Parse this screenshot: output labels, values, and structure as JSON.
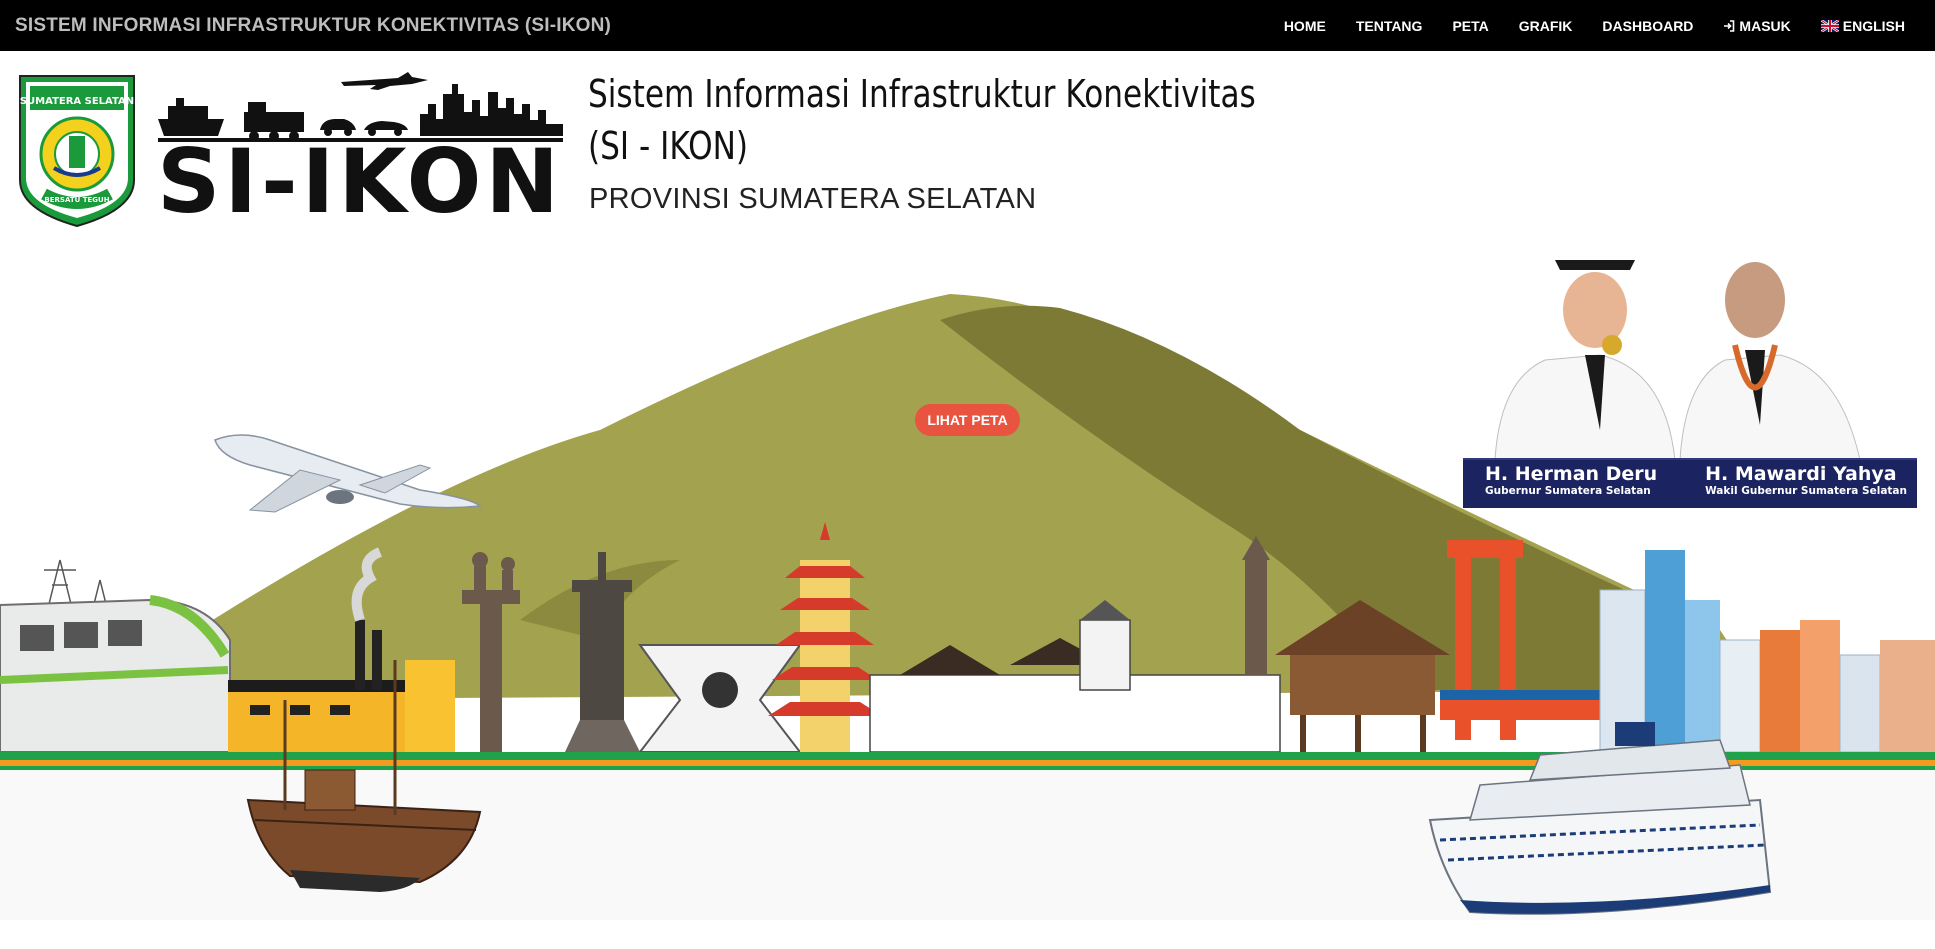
{
  "navbar": {
    "brand": "SISTEM INFORMASI INFRASTRUKTUR KONEKTIVITAS (SI-IKON)",
    "items": [
      {
        "label": "HOME"
      },
      {
        "label": "TENTANG"
      },
      {
        "label": "PETA"
      },
      {
        "label": "GRAFIK"
      },
      {
        "label": "DASHBOARD"
      },
      {
        "label": "MASUK",
        "icon": "sign-in-icon"
      },
      {
        "label": "ENGLISH",
        "icon": "uk-flag-icon"
      }
    ]
  },
  "header": {
    "logo_text": "SI-IKON",
    "emblem_top_text": "SUMATERA SELATAN",
    "emblem_bottom_text": "BERSATU TEGUH",
    "title_line1": "Sistem Informasi Infrastruktur Konektivitas",
    "title_line2": "(SI - IKON)",
    "subtitle": "PROVINSI SUMATERA SELATAN"
  },
  "hero": {
    "cta_label": "LIHAT PETA"
  },
  "officials": [
    {
      "name": "H. Herman Deru",
      "role": "Gubernur Sumatera Selatan"
    },
    {
      "name": "H. Mawardi Yahya",
      "role": "Wakil Gubernur Sumatera Selatan"
    }
  ],
  "colors": {
    "navbar_bg": "#000000",
    "cta_bg": "#e8543f",
    "mountain": "#a3a24f",
    "mountain_shadow": "#7d7a36",
    "officials_bar": "#1b2461",
    "ground_green": "#1fa24a",
    "ground_orange": "#f39a21"
  }
}
